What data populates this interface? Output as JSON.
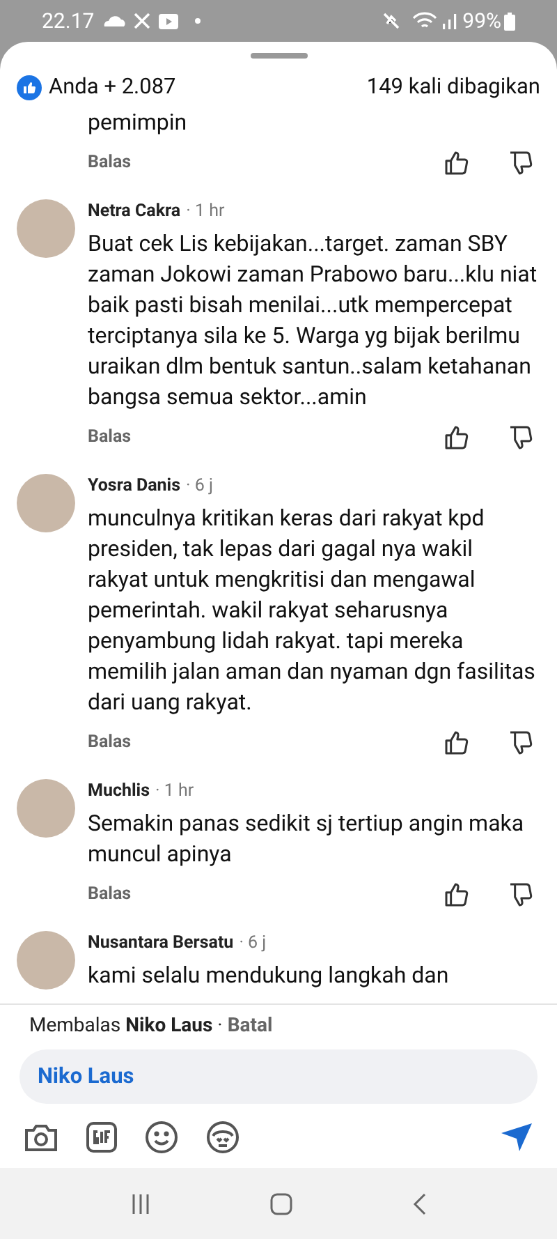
{
  "status_bar": {
    "time": "22.17",
    "battery": "99%"
  },
  "reactions": {
    "summary": "Anda + 2.087",
    "shares": "149 kali dibagikan"
  },
  "comments": [
    {
      "kind": "partial",
      "text": "pemimpin",
      "reply": "Balas"
    },
    {
      "kind": "full",
      "author": "Netra Cakra",
      "time": "· 1 hr",
      "text": "Buat cek Lis kebijakan...target. zaman SBY zaman Jokowi zaman Prabowo baru...klu niat baik pasti bisah menilai...utk mempercepat terciptanya sila ke 5. Warga yg bijak berilmu uraikan dlm bentuk santun..salam ketahanan bangsa semua sektor...amin",
      "reply": "Balas"
    },
    {
      "kind": "full",
      "author": "Yosra Danis",
      "time": "· 6 j",
      "text": "munculnya kritikan keras dari rakyat kpd presiden, tak lepas dari gagal nya wakil rakyat untuk mengkritisi dan mengawal pemerintah. wakil rakyat seharusnya penyambung lidah rakyat. tapi mereka memilih jalan aman dan nyaman dgn fasilitas dari uang rakyat.",
      "reply": "Balas"
    },
    {
      "kind": "full",
      "author": "Muchlis",
      "time": "· 1 hr",
      "text": "Semakin panas sedikit sj tertiup angin maka muncul apinya",
      "reply": "Balas"
    },
    {
      "kind": "cut",
      "author": "Nusantara Bersatu",
      "time": "· 6 j",
      "text": "kami selalu mendukung langkah dan"
    }
  ],
  "reply_bar": {
    "prefix": "Membalas",
    "name": "Niko Laus",
    "separator": "·",
    "cancel": "Batal"
  },
  "composer": {
    "value": "Niko Laus"
  }
}
